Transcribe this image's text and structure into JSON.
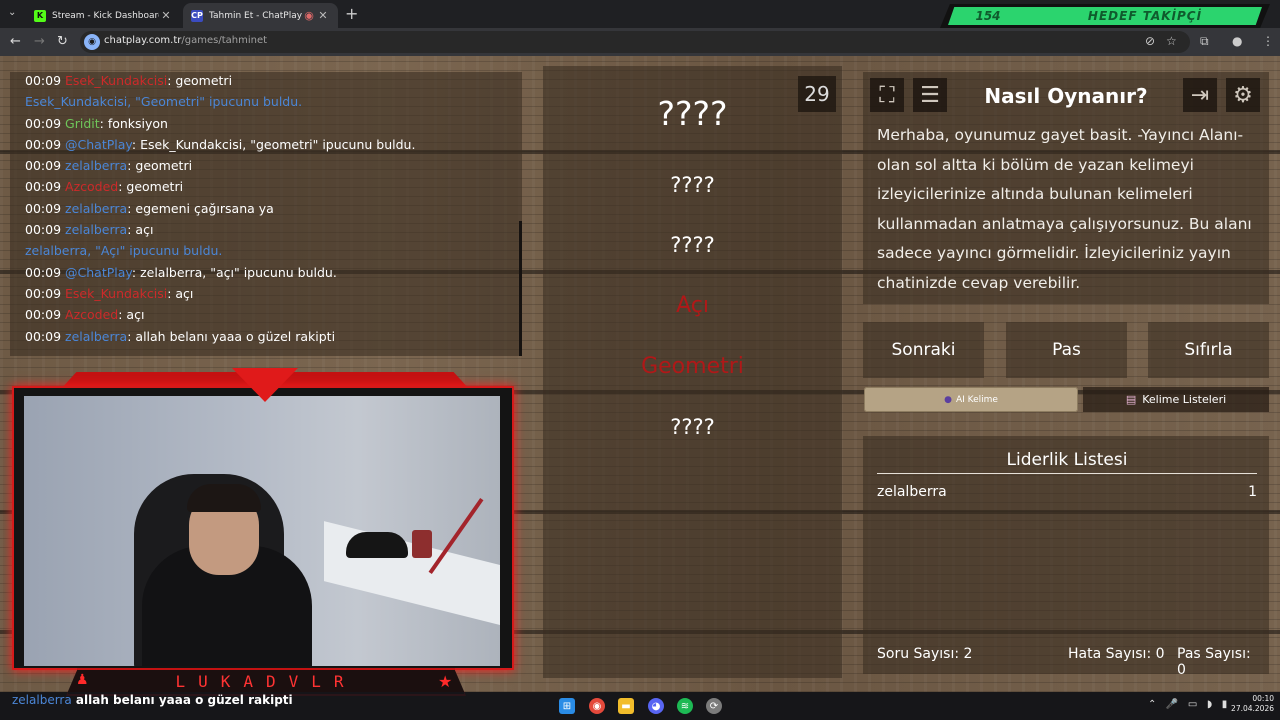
{
  "browser": {
    "tabs": [
      {
        "label": "Stream - Kick Dashboard",
        "icon": "kick-icon",
        "active": false
      },
      {
        "label": "Tahmin Et - ChatPlay",
        "icon": "chatplay-icon",
        "active": true
      }
    ],
    "url_host": "chatplay.com.tr",
    "url_path": "/games/tahminet",
    "overlay": {
      "count": "154",
      "label": "HEDEF TAKİPÇİ"
    }
  },
  "chat": {
    "lines": [
      {
        "time": "00:09",
        "user": "Esek_Kundakcisi",
        "user_color": "red",
        "sep": ": ",
        "msg": "geometri"
      },
      {
        "time": "",
        "user": "Esek_Kundakcisi",
        "user_color": "blue",
        "sep": ", ",
        "msg": "\"Geometri\" ipucunu buldu.",
        "msg_color": "mixed"
      },
      {
        "time": "00:09",
        "user": "Gridit",
        "user_color": "green",
        "sep": ": ",
        "msg": "fonksiyon"
      },
      {
        "time": "00:09",
        "user": "@ChatPlay",
        "user_color": "blue",
        "sep": ": ",
        "msg": "Esek_Kundakcisi, \"geometri\" ipucunu buldu."
      },
      {
        "time": "00:09",
        "user": "zelalberra",
        "user_color": "blue",
        "sep": ": ",
        "msg": "geometri"
      },
      {
        "time": "00:09",
        "user": "Azcoded",
        "user_color": "red",
        "sep": ": ",
        "msg": "geometri"
      },
      {
        "time": "00:09",
        "user": "zelalberra",
        "user_color": "blue",
        "sep": ": ",
        "msg": "egemeni çağırsana ya"
      },
      {
        "time": "00:09",
        "user": "zelalberra",
        "user_color": "blue",
        "sep": ": ",
        "msg": "açı"
      },
      {
        "time": "",
        "user": "zelalberra",
        "user_color": "blue",
        "sep": ", ",
        "msg": "\"Açı\" ipucunu buldu.",
        "msg_color": "mixed"
      },
      {
        "time": "00:09",
        "user": "@ChatPlay",
        "user_color": "blue",
        "sep": ": ",
        "msg": "zelalberra, \"açı\" ipucunu buldu."
      },
      {
        "time": "00:09",
        "user": "Esek_Kundakcisi",
        "user_color": "red",
        "sep": ": ",
        "msg": "açı"
      },
      {
        "time": "00:09",
        "user": "Azcoded",
        "user_color": "red",
        "sep": ": ",
        "msg": "açı"
      },
      {
        "time": "00:09",
        "user": "zelalberra",
        "user_color": "blue",
        "sep": ": ",
        "msg": "allah belanı yaaa o güzel rakipti"
      }
    ]
  },
  "game": {
    "timer": "29",
    "words": [
      {
        "text": "????",
        "found": false
      },
      {
        "text": "????",
        "found": false
      },
      {
        "text": "????",
        "found": false
      },
      {
        "text": "Açı",
        "found": true
      },
      {
        "text": "Geometri",
        "found": true
      },
      {
        "text": "????",
        "found": false
      }
    ]
  },
  "info": {
    "title": "Nasıl Oynanır?",
    "text": "Merhaba, oyunumuz gayet basit. -Yayıncı Alanı- olan sol altta ki bölüm de yazan kelimeyi izleyicilerinize altında bulunan kelimeleri kullanmadan anlatmaya çalışıyorsunuz. Bu alanı sadece yayıncı görmelidir. İzleyicileriniz yayın chatinizde cevap verebilir."
  },
  "controls": {
    "next": "Sonraki",
    "pass": "Pas",
    "reset": "Sıfırla",
    "ai_word": "AI Kelime",
    "word_lists": "Kelime Listeleri"
  },
  "leaderboard": {
    "title": "Liderlik Listesi",
    "rows": [
      {
        "name": "zelalberra",
        "score": "1"
      }
    ],
    "stats": {
      "question_count": "Soru Sayısı: 2",
      "error_count": "Hata Sayısı: 0",
      "pass_count": "Pas Sayısı: 0"
    }
  },
  "webcam": {
    "name": "LUKADVLR"
  },
  "ticker": {
    "user": "zelalberra",
    "msg": "allah belanı yaaa o güzel rakipti"
  },
  "taskbar": {
    "time": "00:10",
    "date": "27.04.2026"
  },
  "colors": {
    "user_blue": "#4b86d6",
    "user_red": "#cc2a2a",
    "user_green": "#6fc55a",
    "found_word": "#b01818",
    "overlay_green": "#2bd46e"
  }
}
